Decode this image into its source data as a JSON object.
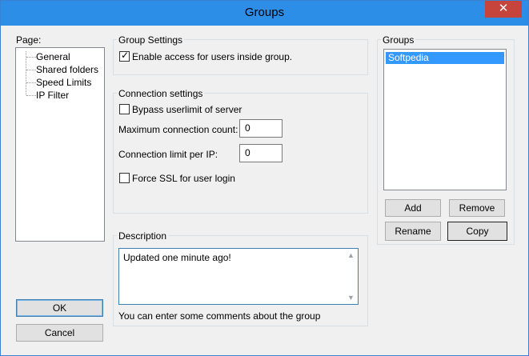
{
  "window": {
    "title": "Groups",
    "close_glyph": "✕"
  },
  "page_nav": {
    "label": "Page:",
    "items": [
      "General",
      "Shared folders",
      "Speed Limits",
      "IP Filter"
    ]
  },
  "group_settings": {
    "title": "Group Settings",
    "enable_access": {
      "label": "Enable access for users inside group.",
      "checked": true
    }
  },
  "connection_settings": {
    "title": "Connection settings",
    "bypass": {
      "label": "Bypass userlimit of server",
      "checked": false
    },
    "max_conn_label": "Maximum connection count:",
    "max_conn_value": "0",
    "limit_ip_label": "Connection limit per IP:",
    "limit_ip_value": "0",
    "force_ssl": {
      "label": "Force SSL for user login",
      "checked": false
    }
  },
  "description": {
    "title": "Description",
    "text": "Updated one minute ago!",
    "hint": "You can enter some comments about the group"
  },
  "groups": {
    "title": "Groups",
    "items": [
      "Softpedia"
    ],
    "selected": 0,
    "add_label": "Add",
    "remove_label": "Remove",
    "rename_label": "Rename",
    "copy_label": "Copy"
  },
  "footer": {
    "ok_label": "OK",
    "cancel_label": "Cancel"
  },
  "colors": {
    "titlebar": "#2d8ee8",
    "close": "#c7443d",
    "selection": "#3399ff"
  }
}
